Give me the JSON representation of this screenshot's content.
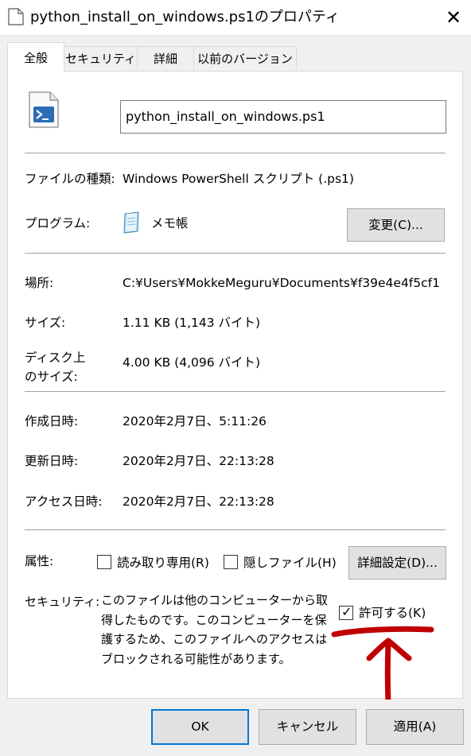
{
  "window": {
    "title": "python_install_on_windows.ps1のプロパティ",
    "close_glyph": "✕"
  },
  "tabs": [
    {
      "label": "全般",
      "active": true
    },
    {
      "label": "セキュリティ",
      "active": false
    },
    {
      "label": "詳細",
      "active": false
    },
    {
      "label": "以前のバージョン",
      "active": false
    }
  ],
  "general": {
    "filename": "python_install_on_windows.ps1",
    "file_type_label": "ファイルの種類:",
    "file_type_value": "Windows PowerShell スクリプト (.ps1)",
    "program_label": "プログラム:",
    "program_value": "メモ帳",
    "change_button": "変更(C)...",
    "location_label": "場所:",
    "location_value": "C:¥Users¥MokkeMeguru¥Documents¥f39e4e4f5cf1",
    "size_label": "サイズ:",
    "size_value": "1.11 KB (1,143 バイト)",
    "disk_size_label_line1": "ディスク上",
    "disk_size_label_line2": "のサイズ:",
    "disk_size_value": "4.00 KB (4,096 バイト)",
    "created_label": "作成日時:",
    "created_value": "2020年2月7日、5:11:26",
    "modified_label": "更新日時:",
    "modified_value": "2020年2月7日、22:13:28",
    "accessed_label": "アクセス日時:",
    "accessed_value": "2020年2月7日、22:13:28",
    "attributes_label": "属性:",
    "readonly_label": "読み取り専用(R)",
    "readonly_checked": false,
    "hidden_label": "隠しファイル(H)",
    "hidden_checked": false,
    "advanced_button": "詳細設定(D)...",
    "security_label": "セキュリティ:",
    "security_text": "このファイルは他のコンピューターから取得したものです。このコンピューターを保護するため、このファイルへのアクセスはブロックされる可能性があります。",
    "unblock_label": "許可する(K)",
    "unblock_checked": true,
    "checkmark_glyph": "✓"
  },
  "footer": {
    "ok": "OK",
    "cancel": "キャンセル",
    "apply": "適用(A)"
  },
  "colors": {
    "annotation_arrow": "#c00000",
    "focus_border": "#0078d7"
  }
}
